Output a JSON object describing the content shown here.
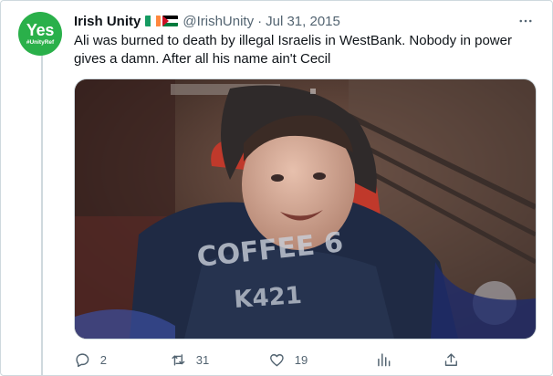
{
  "tweet": {
    "avatar": {
      "main_text": "Yes",
      "sub_text": "#UnityRef",
      "color": "#2ab04a"
    },
    "author_name": "Irish Unity",
    "author_flags": [
      "flag-ireland-icon",
      "flag-palestine-icon"
    ],
    "handle": "@IrishUnity",
    "separator": "·",
    "date": "Jul 31, 2015",
    "text": "Ali was burned to death by illegal Israelis in WestBank. Nobody in power gives a damn. After all his name ain't Cecil",
    "more_icon": "ellipsis-icon",
    "media": {
      "type": "photo",
      "shirt_text": "COFFEE 6",
      "shirt_number": "K421"
    }
  },
  "actions": {
    "reply": {
      "icon": "reply-icon",
      "count": "2"
    },
    "retweet": {
      "icon": "retweet-icon",
      "count": "31"
    },
    "like": {
      "icon": "heart-icon",
      "count": "19"
    },
    "views": {
      "icon": "views-icon"
    },
    "share": {
      "icon": "share-icon"
    }
  },
  "colors": {
    "text": "#0f1419",
    "secondary": "#536471",
    "border": "#cfd9de",
    "accent": "#2ab04a"
  }
}
